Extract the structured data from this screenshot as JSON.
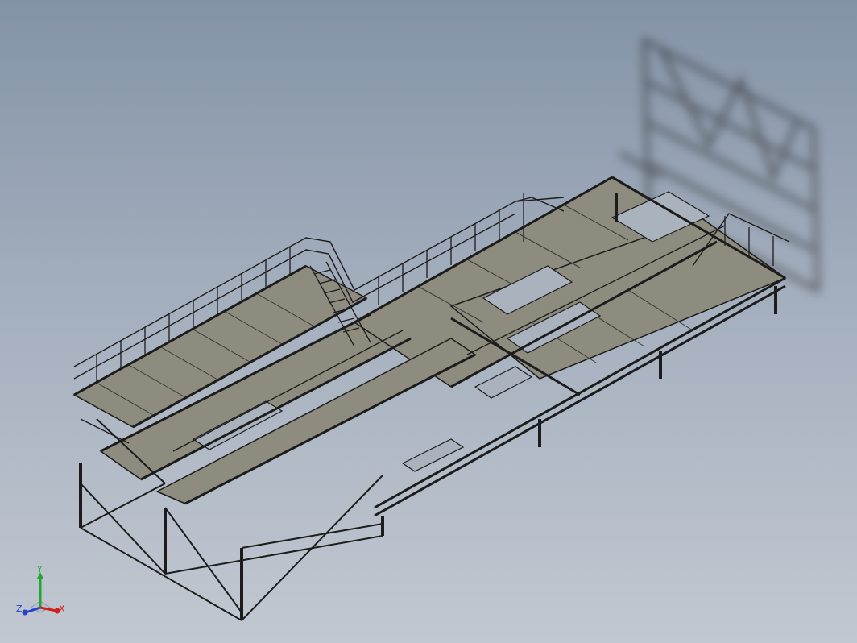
{
  "viewport": {
    "background_top": "#8393a6",
    "background_bottom": "#c2c8d1",
    "model_color": "#8d8c7e",
    "edge_color": "#1c1c1c"
  },
  "triad": {
    "x_label": "X",
    "y_label": "Y",
    "z_label": "Z",
    "x_color": "#d11f1f",
    "y_color": "#1fa82c",
    "z_color": "#2344c8"
  }
}
